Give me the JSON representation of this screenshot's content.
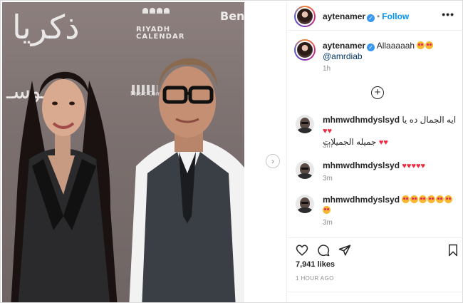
{
  "post": {
    "author": "aytenamer",
    "follow_label": "Follow",
    "more_label": "•••",
    "dot_sep": "•"
  },
  "photo": {
    "backdrop": {
      "arabic_top": "ذكريا",
      "arabic_mid": "مـوسـ",
      "riyadh_line1": "RIYADH",
      "riyadh_line2": "CALENDAR",
      "brand_fragment": "Ben",
      "music_text": "Music Commission"
    }
  },
  "caption": {
    "username": "aytenamer",
    "text": "Allaaaaah",
    "mention": "@amrdiab",
    "time": "1h"
  },
  "load_more_label": "+",
  "comments": [
    {
      "username": "mhmwdhmdyslsyd",
      "text": "ايه الجمال ده يا",
      "text2": "جميله الجميلات",
      "time": "3m"
    },
    {
      "username": "mhmwdhmdyslsyd",
      "text": "",
      "time": "3m"
    },
    {
      "username": "mhmwdhmdyslsyd",
      "text": "",
      "time": "3m"
    }
  ],
  "icons": {
    "heart": "♥",
    "like": "heart-outline-icon",
    "comment": "comment-bubble-icon",
    "share": "paper-plane-icon",
    "save": "bookmark-icon",
    "next": "chevron-right-icon",
    "verified": "✓"
  },
  "likes": "7,941 likes",
  "posted_ago": "1 HOUR AGO",
  "colors": {
    "accent": "#0095f6",
    "heart": "#ed2b43",
    "verified": "#3897f0"
  }
}
